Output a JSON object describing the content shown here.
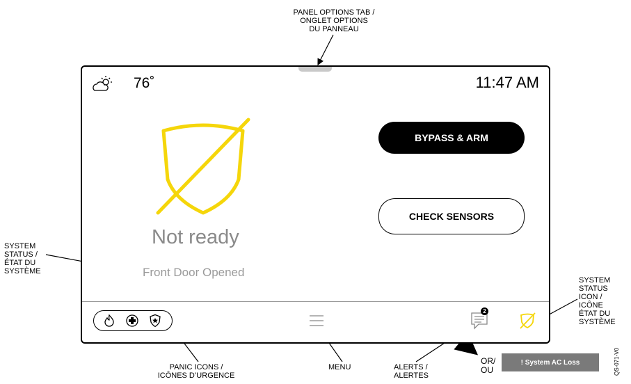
{
  "callouts": {
    "panel_options": [
      "PANEL OPTIONS TAB /",
      "ONGLET OPTIONS",
      "DU PANNEAU"
    ],
    "system_status": [
      "SYSTEM",
      "STATUS /",
      "ÉTAT DU",
      "SYSTÈME"
    ],
    "system_status_icon": [
      "SYSTEM",
      "STATUS",
      "ICON /",
      "ICÔNE",
      "ÉTAT DU",
      "SYSTÈME"
    ],
    "panic_icons": [
      "PANIC ICONS /",
      "ICÔNES D’URGENCE"
    ],
    "menu": "MENU",
    "alerts": [
      "ALERTS /",
      "ALERTES"
    ],
    "or": [
      "OR/",
      "OU"
    ]
  },
  "header": {
    "temperature": "76˚",
    "time": "11:47 AM"
  },
  "status": {
    "title": "Not ready",
    "subtitle": "Front Door Opened"
  },
  "buttons": {
    "bypass_arm": "BYPASS & ARM",
    "check_sensors": "CHECK SENSORS"
  },
  "alerts": {
    "badge": "2"
  },
  "toast": "! System AC Loss",
  "ref_code": "QS-071-V0",
  "colors": {
    "status_yellow": "#F5D60A",
    "button_dark": "#000000",
    "toast_gray": "#7A7A7A"
  },
  "icons": [
    "cloud-sun-icon",
    "shield-slash-icon",
    "fire-icon",
    "medical-icon",
    "police-icon",
    "menu-icon",
    "chat-icon"
  ]
}
